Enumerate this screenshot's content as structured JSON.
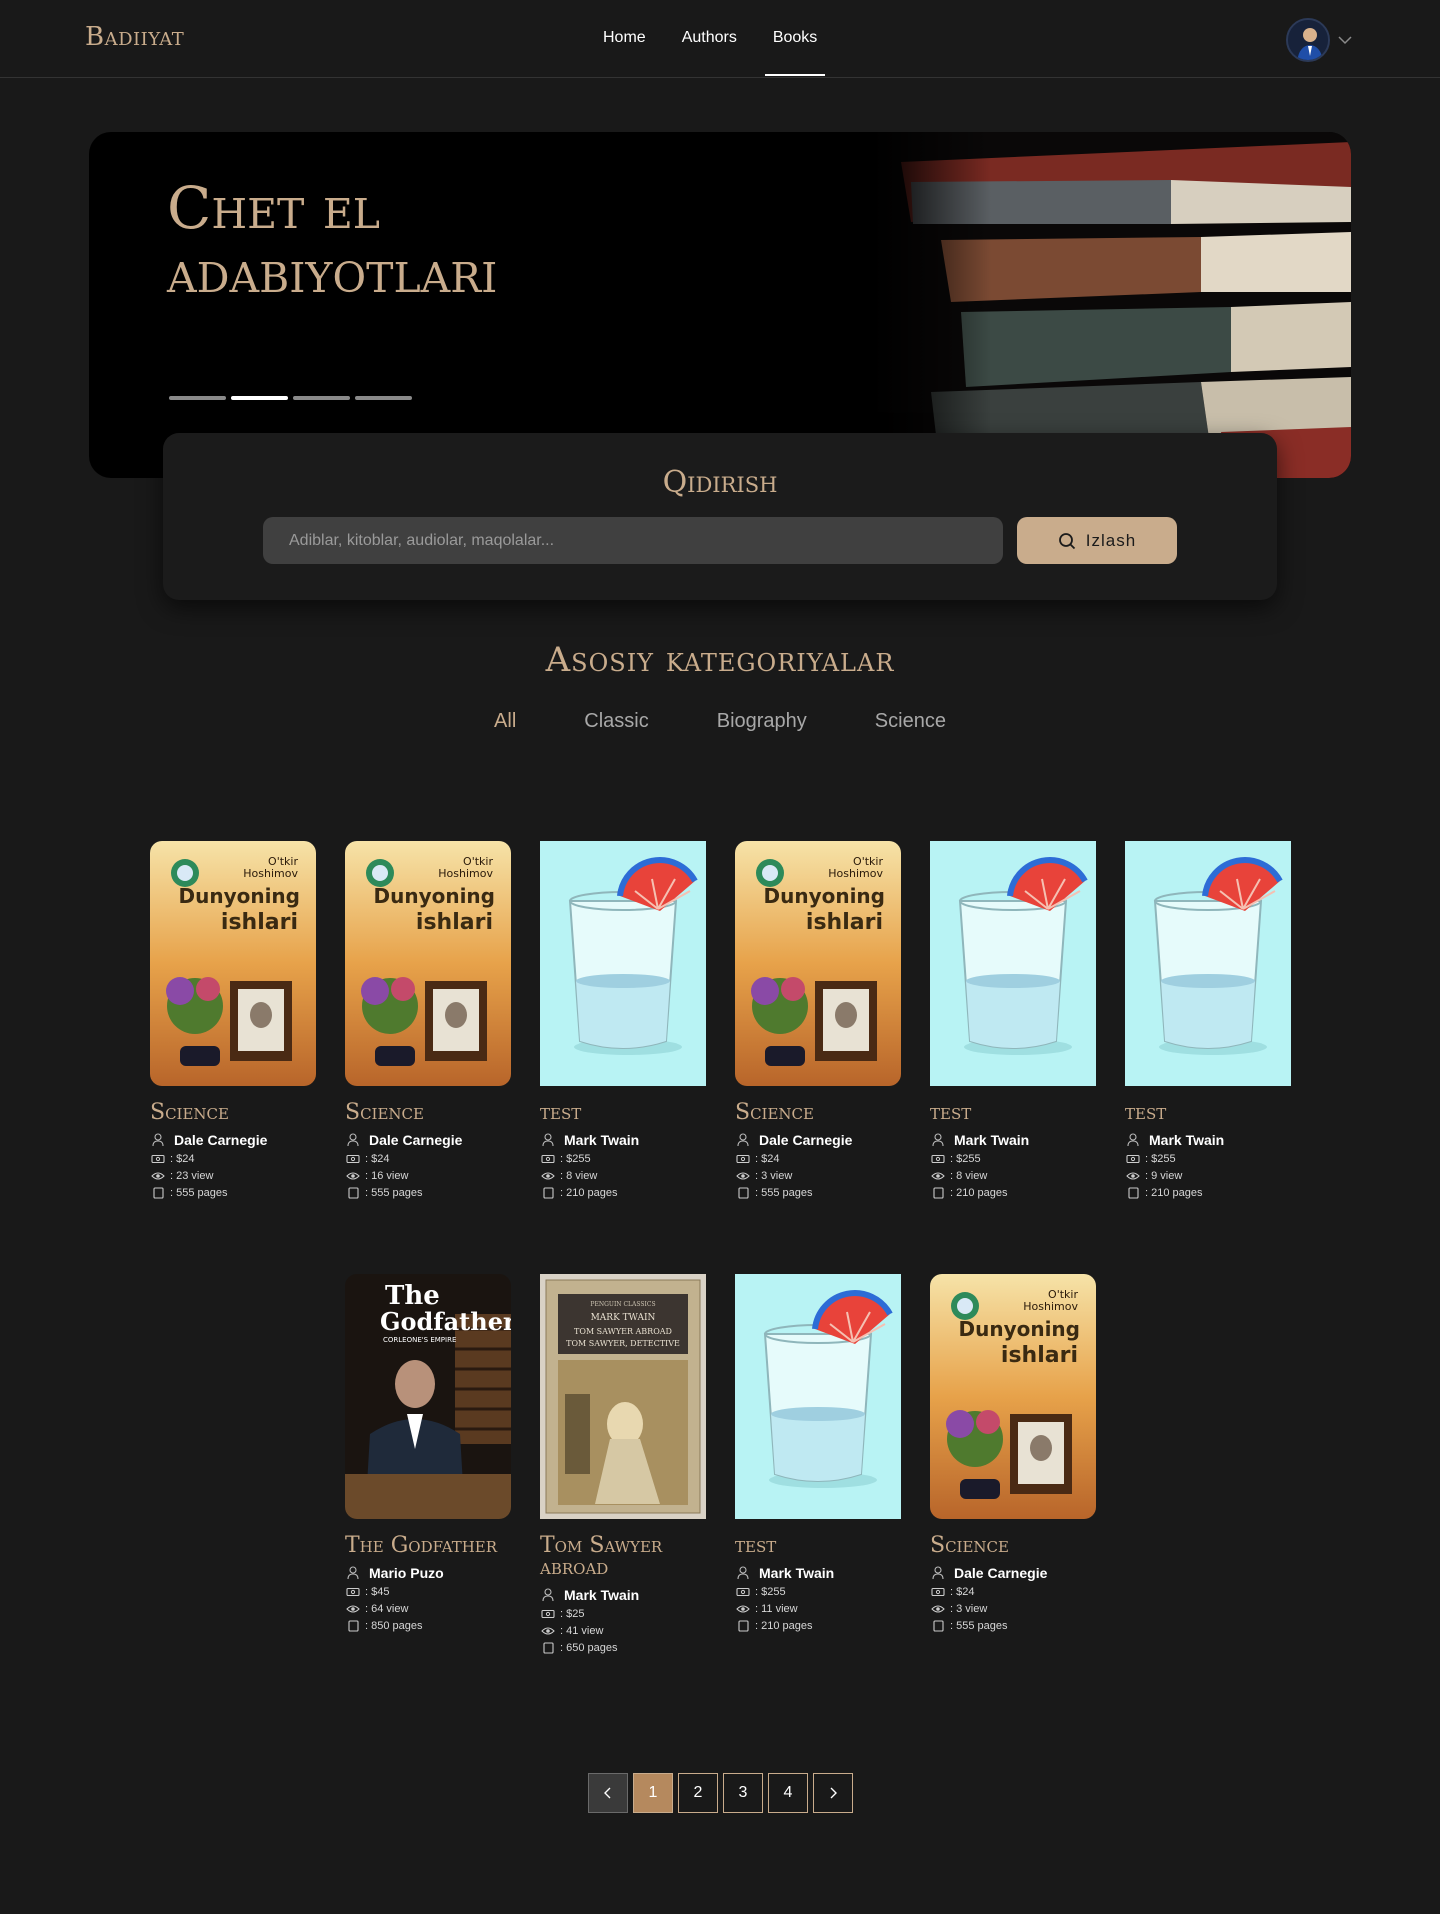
{
  "navbar": {
    "logo": "Badiiyat",
    "links": [
      {
        "label": "Home",
        "active": false
      },
      {
        "label": "Authors",
        "active": false
      },
      {
        "label": "Books",
        "active": true
      }
    ]
  },
  "hero": {
    "title_line1": "Chet el",
    "title_line2": "adabiyotlari",
    "slides_count": 4,
    "active_slide": 2
  },
  "search": {
    "title": "Qidirish",
    "placeholder": "Adiblar, kitoblar, audiolar, maqolalar...",
    "button_label": "Izlash"
  },
  "categories": {
    "title": "Asosiy kategoriyalar",
    "tabs": [
      "All",
      "Classic",
      "Biography",
      "Science"
    ],
    "active_tab": "All"
  },
  "books": [
    {
      "title": "Science",
      "author": "Dale Carnegie",
      "price": ": $24",
      "views": ": 23 view",
      "pages": ": 555 pages",
      "cover": "dunyoning-islari"
    },
    {
      "title": "Science",
      "author": "Dale Carnegie",
      "price": ": $24",
      "views": ": 16 view",
      "pages": ": 555 pages",
      "cover": "dunyoning-islari"
    },
    {
      "title": "test",
      "author": "Mark Twain",
      "price": ": $255",
      "views": ": 8 view",
      "pages": ": 210 pages",
      "cover": "glass"
    },
    {
      "title": "Science",
      "author": "Dale Carnegie",
      "price": ": $24",
      "views": ": 3 view",
      "pages": ": 555 pages",
      "cover": "dunyoning-islari"
    },
    {
      "title": "test",
      "author": "Mark Twain",
      "price": ": $255",
      "views": ": 8 view",
      "pages": ": 210 pages",
      "cover": "glass"
    },
    {
      "title": "test",
      "author": "Mark Twain",
      "price": ": $255",
      "views": ": 9 view",
      "pages": ": 210 pages",
      "cover": "glass"
    },
    {
      "title": "The Godfather",
      "author": "Mario Puzo",
      "price": ": $45",
      "views": ": 64 view",
      "pages": ": 850 pages",
      "cover": "godfather"
    },
    {
      "title": "Tom Sawyer abroad",
      "author": "Mark Twain",
      "price": ": $25",
      "views": ": 41 view",
      "pages": ": 650 pages",
      "cover": "tom-sawyer"
    },
    {
      "title": "test",
      "author": "Mark Twain",
      "price": ": $255",
      "views": ": 11 view",
      "pages": ": 210 pages",
      "cover": "glass"
    },
    {
      "title": "Science",
      "author": "Dale Carnegie",
      "price": ": $24",
      "views": ": 3 view",
      "pages": ": 555 pages",
      "cover": "dunyoning-islari"
    }
  ],
  "covers": {
    "dunyoning": {
      "line1": "O'tkir",
      "line2": "Hoshimov",
      "line3": "Dunyoning",
      "line4": "ishlari"
    },
    "godfather": {
      "line1": "The",
      "line2": "Godfather",
      "line3": "CORLEONE'S EMPIRE"
    },
    "tom": {
      "line1": "PENGUIN CLASSICS",
      "line2": "MARK TWAIN",
      "line3": "TOM SAWYER ABROAD",
      "line4": "TOM SAWYER, DETECTIVE"
    }
  },
  "pagination": {
    "pages": [
      "1",
      "2",
      "3",
      "4"
    ],
    "current": "1",
    "prev_icon": "chevron-left-icon",
    "next_icon": "chevron-right-icon"
  },
  "colors": {
    "background": "#191919",
    "accent": "#c9ac8c",
    "active_page": "#b5895e"
  }
}
